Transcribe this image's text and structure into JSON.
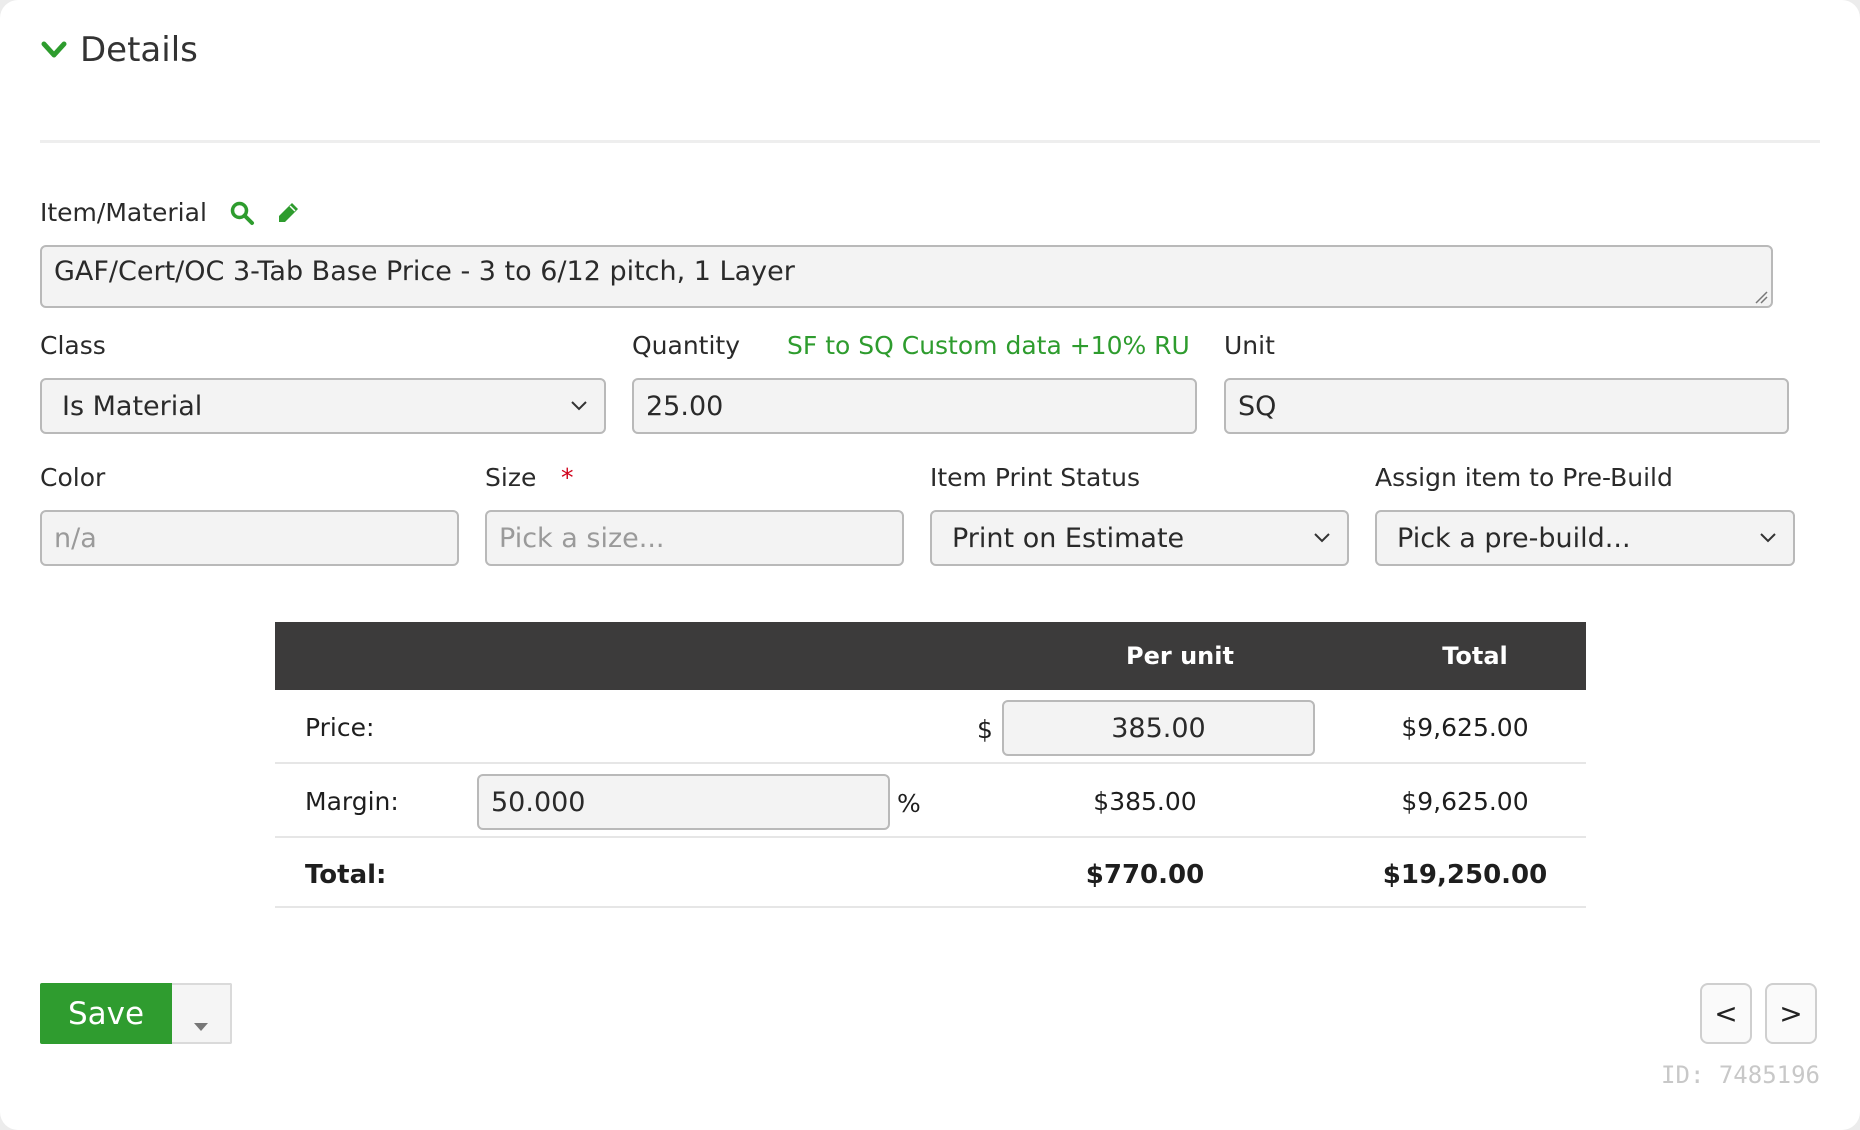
{
  "section": {
    "title": "Details",
    "accent": "#2e9c2e"
  },
  "item_material": {
    "label": "Item/Material",
    "value": "GAF/Cert/OC 3-Tab Base Price - 3 to 6/12 pitch, 1 Layer",
    "icons": [
      "search-icon",
      "pencil-icon"
    ]
  },
  "class": {
    "label": "Class",
    "selected": "Is Material"
  },
  "quantity": {
    "label": "Quantity",
    "formula_link": "SF to SQ Custom data +10% RU",
    "value": "25.00"
  },
  "unit": {
    "label": "Unit",
    "value": "SQ"
  },
  "color": {
    "label": "Color",
    "placeholder": "n/a"
  },
  "size": {
    "label": "Size",
    "required_mark": "*",
    "placeholder": "Pick a size..."
  },
  "print_status": {
    "label": "Item Print Status",
    "selected": "Print on Estimate"
  },
  "prebuild": {
    "label": "Assign item to Pre-Build",
    "selected": "Pick a pre-build..."
  },
  "pricing": {
    "headers": {
      "per_unit": "Per unit",
      "total": "Total"
    },
    "price": {
      "label": "Price:",
      "currency": "$",
      "per_unit": "385.00",
      "total": "$9,625.00"
    },
    "margin": {
      "label": "Margin:",
      "value": "50.000",
      "suffix": "%",
      "per_unit": "$385.00",
      "total": "$9,625.00"
    },
    "grand": {
      "label": "Total:",
      "per_unit": "$770.00",
      "total": "$19,250.00"
    }
  },
  "actions": {
    "save": "Save",
    "prev": "<",
    "next": ">"
  },
  "record_id": "ID: 7485196"
}
